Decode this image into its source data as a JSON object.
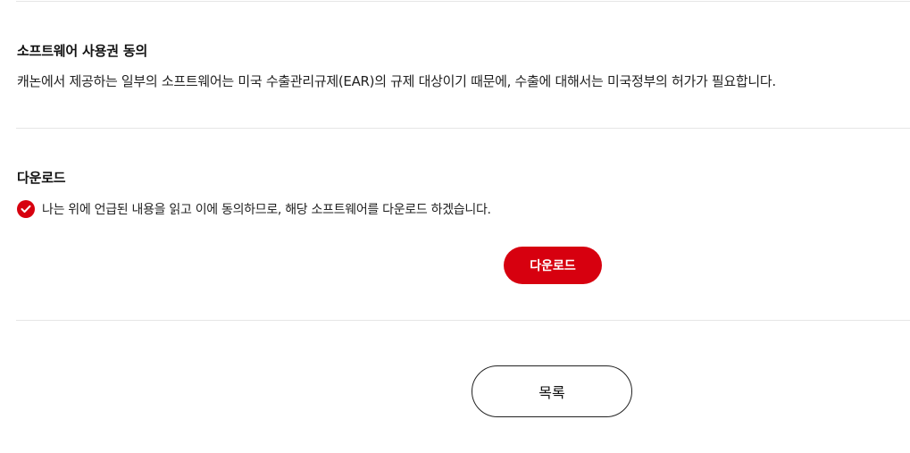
{
  "license": {
    "title": "소프트웨어 사용권 동의",
    "text": "캐논에서 제공하는 일부의 소프트웨어는 미국 수출관리규제(EAR)의 규제 대상이기 때문에, 수출에 대해서는 미국정부의 허가가 필요합니다."
  },
  "download": {
    "title": "다운로드",
    "agree_checked": true,
    "agree_text": "나는 위에 언급된 내용을 읽고 이에 동의하므로, 해당 소프트웨어를 다운로드 하겠습니다.",
    "button_label": "다운로드"
  },
  "footer": {
    "list_button_label": "목록"
  },
  "colors": {
    "accent": "#d7000f",
    "divider": "#e6e6e6"
  },
  "icons": {
    "agree_check": "check-circle-icon"
  }
}
